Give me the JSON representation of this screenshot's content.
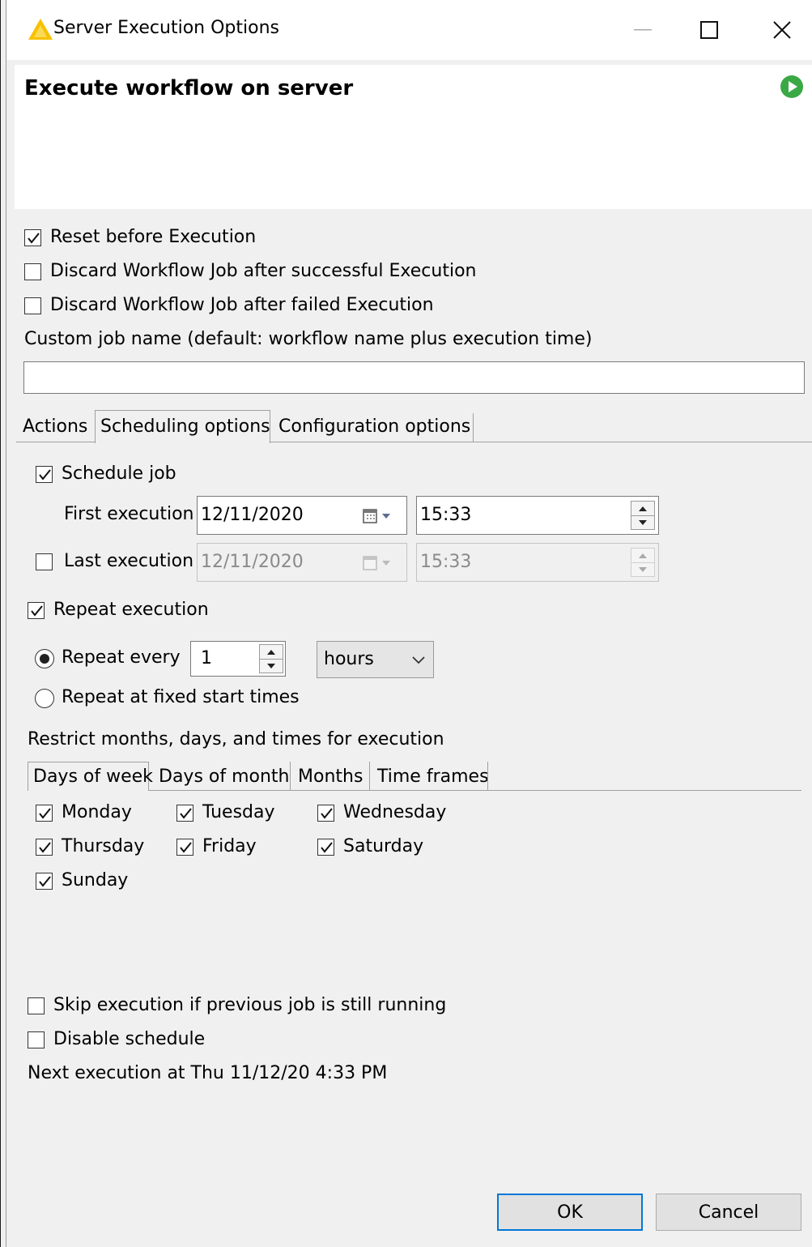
{
  "window": {
    "title": "Server Execution Options"
  },
  "header": {
    "title": "Execute workflow on server"
  },
  "options": {
    "reset_before": {
      "label": "Reset before Execution",
      "checked": true
    },
    "discard_success": {
      "label": "Discard Workflow Job after successful Execution",
      "checked": false
    },
    "discard_failed": {
      "label": "Discard Workflow Job after failed Execution",
      "checked": false
    },
    "custom_job_label": "Custom job name (default: workflow name plus execution time)",
    "custom_job_value": ""
  },
  "tabs": [
    {
      "label": "Actions",
      "active": false
    },
    {
      "label": "Scheduling options",
      "active": true
    },
    {
      "label": "Configuration options",
      "active": false
    }
  ],
  "schedule": {
    "schedule_job": {
      "label": "Schedule job",
      "checked": true
    },
    "first_execution": {
      "label": "First execution",
      "date": "12/11/2020",
      "time": "15:33"
    },
    "last_execution": {
      "label": "Last execution",
      "checked": false,
      "date": "12/11/2020",
      "time": "15:33"
    },
    "repeat_execution": {
      "label": "Repeat execution",
      "checked": true
    },
    "repeat_every": {
      "label": "Repeat every",
      "selected": true,
      "value": "1",
      "unit": "hours"
    },
    "repeat_fixed": {
      "label": "Repeat at fixed start times",
      "selected": false
    },
    "restrict_label": "Restrict months, days, and times for execution",
    "subtabs": [
      {
        "label": "Days of week",
        "active": true
      },
      {
        "label": "Days of month",
        "active": false
      },
      {
        "label": "Months",
        "active": false
      },
      {
        "label": "Time frames",
        "active": false
      }
    ],
    "days": {
      "monday": {
        "label": "Monday",
        "checked": true
      },
      "tuesday": {
        "label": "Tuesday",
        "checked": true
      },
      "wednesday": {
        "label": "Wednesday",
        "checked": true
      },
      "thursday": {
        "label": "Thursday",
        "checked": true
      },
      "friday": {
        "label": "Friday",
        "checked": true
      },
      "saturday": {
        "label": "Saturday",
        "checked": true
      },
      "sunday": {
        "label": "Sunday",
        "checked": true
      }
    },
    "skip_running": {
      "label": "Skip execution if previous job is still running",
      "checked": false
    },
    "disable_schedule": {
      "label": "Disable schedule",
      "checked": false
    },
    "next_execution": "Next execution at Thu 11/12/20 4:33 PM"
  },
  "buttons": {
    "ok": "OK",
    "cancel": "Cancel"
  },
  "colors": {
    "accent": "#0078d7",
    "warning": "#f7c100",
    "run": "#3aa845"
  }
}
